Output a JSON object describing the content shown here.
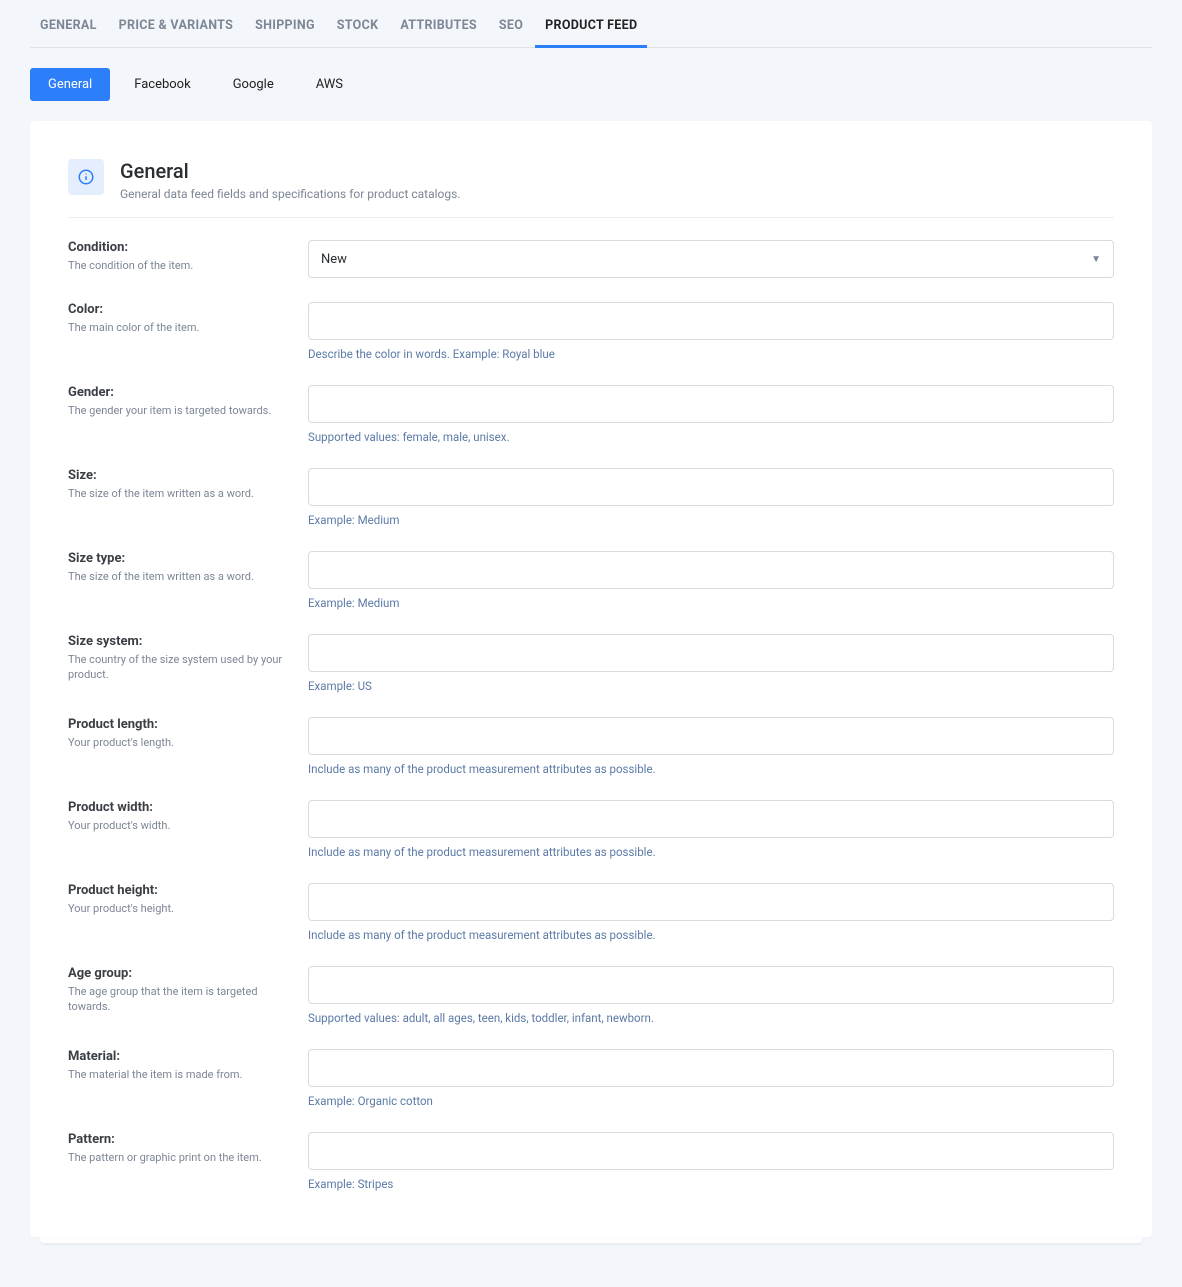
{
  "primary_tabs": [
    {
      "label": "GENERAL",
      "active": false
    },
    {
      "label": "PRICE & VARIANTS",
      "active": false
    },
    {
      "label": "SHIPPING",
      "active": false
    },
    {
      "label": "STOCK",
      "active": false
    },
    {
      "label": "ATTRIBUTES",
      "active": false
    },
    {
      "label": "SEO",
      "active": false
    },
    {
      "label": "PRODUCT FEED",
      "active": true
    }
  ],
  "sub_tabs": [
    {
      "label": "General",
      "active": true
    },
    {
      "label": "Facebook",
      "active": false
    },
    {
      "label": "Google",
      "active": false
    },
    {
      "label": "AWS",
      "active": false
    }
  ],
  "section": {
    "title": "General",
    "subtitle": "General data feed fields and specifications for product catalogs."
  },
  "fields": {
    "condition": {
      "label": "Condition:",
      "desc": "The condition of the item.",
      "value": "New",
      "hint": ""
    },
    "color": {
      "label": "Color:",
      "desc": "The main color of the item.",
      "value": "",
      "hint": "Describe the color in words. Example: Royal blue"
    },
    "gender": {
      "label": "Gender:",
      "desc": "The gender your item is targeted towards.",
      "value": "",
      "hint": "Supported values: female, male, unisex."
    },
    "size": {
      "label": "Size:",
      "desc": "The size of the item written as a word.",
      "value": "",
      "hint": "Example: Medium"
    },
    "size_type": {
      "label": "Size type:",
      "desc": "The size of the item written as a word.",
      "value": "",
      "hint": "Example: Medium"
    },
    "size_system": {
      "label": "Size system:",
      "desc": "The country of the size system used by your product.",
      "value": "",
      "hint": "Example: US"
    },
    "product_length": {
      "label": "Product length:",
      "desc": "Your product's length.",
      "value": "",
      "hint": "Include as many of the product measurement attributes as possible."
    },
    "product_width": {
      "label": "Product width:",
      "desc": "Your product's width.",
      "value": "",
      "hint": "Include as many of the product measurement attributes as possible."
    },
    "product_height": {
      "label": "Product height:",
      "desc": "Your product's height.",
      "value": "",
      "hint": "Include as many of the product measurement attributes as possible."
    },
    "age_group": {
      "label": "Age group:",
      "desc": "The age group that the item is targeted towards.",
      "value": "",
      "hint": "Supported values: adult, all ages, teen, kids, toddler, infant, newborn."
    },
    "material": {
      "label": "Material:",
      "desc": "The material the item is made from.",
      "value": "",
      "hint": "Example: Organic cotton"
    },
    "pattern": {
      "label": "Pattern:",
      "desc": "The pattern or graphic print on the item.",
      "value": "",
      "hint": "Example: Stripes"
    }
  }
}
